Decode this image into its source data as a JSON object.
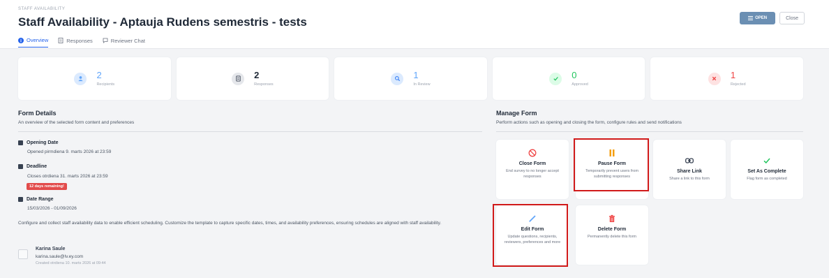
{
  "header": {
    "eyebrow": "STAFF AVAILABILITY",
    "title": "Staff Availability - Aptauja Rudens semestris - tests",
    "open_label": "OPEN",
    "close_label": "Close"
  },
  "tabs": [
    {
      "label": "Overview",
      "icon": "info-icon",
      "active": true
    },
    {
      "label": "Responses",
      "icon": "document-icon",
      "active": false
    },
    {
      "label": "Reviewer Chat",
      "icon": "chat-icon",
      "active": false
    }
  ],
  "stats": [
    {
      "value": "2",
      "label": "Recipients",
      "icon": "user-icon",
      "color": "#60a5fa"
    },
    {
      "value": "2",
      "label": "Responses",
      "icon": "document-icon",
      "color": "#374151"
    },
    {
      "value": "1",
      "label": "In Review",
      "icon": "search-icon",
      "color": "#60a5fa"
    },
    {
      "value": "0",
      "label": "Approved",
      "icon": "check-icon",
      "color": "#22c55e"
    },
    {
      "value": "1",
      "label": "Rejected",
      "icon": "x-icon",
      "color": "#ef4444"
    }
  ],
  "form_details": {
    "heading": "Form Details",
    "subheading": "An overview of the selected form content and preferences",
    "opening_label": "Opening Date",
    "opening_value": "Opened pirmdiena 9. marts 2026 at 23:59",
    "deadline_label": "Deadline",
    "deadline_value": "Closes otrdiena 31. marts 2026 at 23:59",
    "deadline_badge": "12 days remaining!",
    "range_label": "Date Range",
    "range_value": "15/03/2026 - 01/09/2026",
    "description": "Configure and collect staff availability data to enable efficient scheduling. Customize the template to capture specific dates, times, and availability preferences, ensuring schedules are aligned with staff availability.",
    "owner_name": "Karina Saule",
    "owner_email": "karina.saule@lv.ey.com",
    "owner_created": "Created otrdiena 10. marts 2026 at 09:44"
  },
  "manage_form": {
    "heading": "Manage Form",
    "subheading": "Perform actions such as opening and closing the form, configure rules and send notifications",
    "actions": [
      {
        "title": "Close Form",
        "desc": "End survey to no longer accept responses",
        "icon": "ban-icon",
        "color": "#ef4444"
      },
      {
        "title": "Pause Form",
        "desc": "Temporarily prevent users from submitting responses",
        "icon": "pause-icon",
        "color": "#f59e0b"
      },
      {
        "title": "Share Link",
        "desc": "Share a link to this form",
        "icon": "link-icon",
        "color": "#374151"
      },
      {
        "title": "Set As Complete",
        "desc": "Flag form as completed",
        "icon": "check-icon",
        "color": "#22c55e"
      },
      {
        "title": "Edit Form",
        "desc": "Update questions, recipients, reviewers, preferences and more",
        "icon": "pencil-icon",
        "color": "#60a5fa"
      },
      {
        "title": "Delete Form",
        "desc": "Permanently delete this form",
        "icon": "trash-icon",
        "color": "#ef4444"
      }
    ]
  },
  "colors": {
    "accent": "#2563eb",
    "open_button": "#6b8fb3",
    "highlight": "#d11a1a",
    "badge": "#e24b4b"
  }
}
